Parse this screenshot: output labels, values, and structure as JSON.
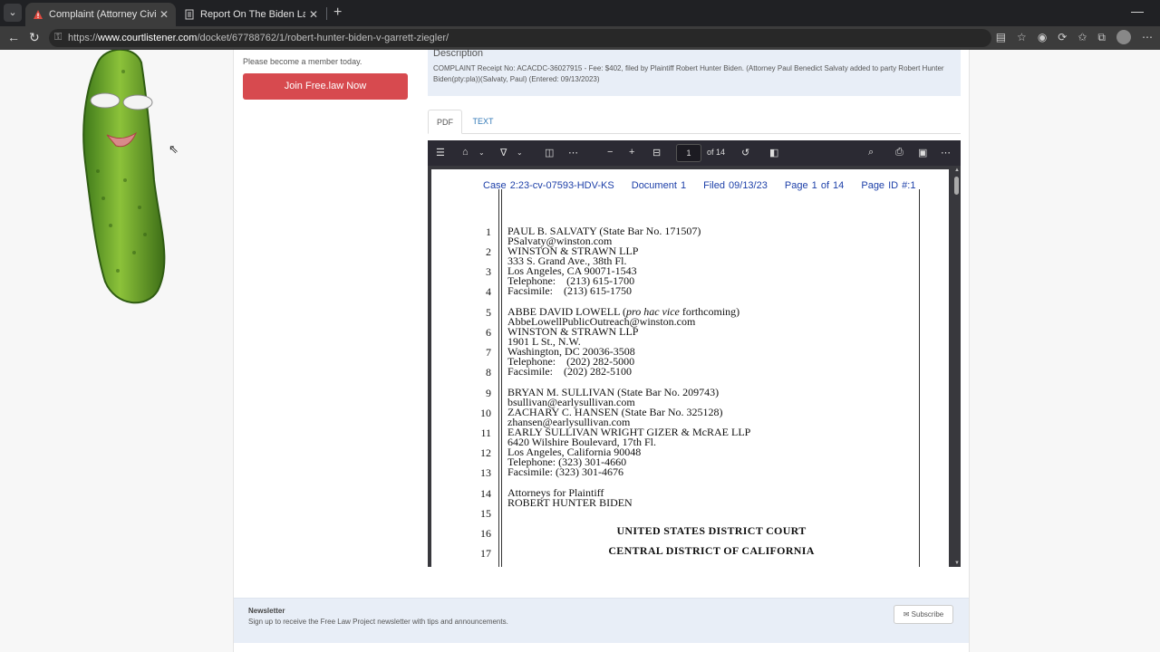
{
  "browser": {
    "tabs": [
      {
        "title": "Complaint (Attorney Civil Case Op",
        "active": true
      },
      {
        "title": "Report On The Biden Laptop : Mar",
        "active": false
      }
    ],
    "url_prefix": "https://",
    "url_host": "www.courtlistener.com",
    "url_path": "/docket/67788762/1/robert-hunter-biden-v-garrett-ziegler/"
  },
  "sidebar": {
    "member_text": "Please become a member today.",
    "join_label": "Join Free.law Now"
  },
  "description": {
    "title": "Description",
    "body": "COMPLAINT Receipt No: ACACDC-36027915 - Fee: $402, filed by Plaintiff Robert Hunter Biden. (Attorney Paul Benedict Salvaty added to party Robert Hunter Biden(pty:pla))(Salvaty, Paul) (Entered: 09/13/2023)"
  },
  "pdf_tabs": {
    "pdf": "PDF",
    "text": "TEXT"
  },
  "viewer": {
    "page_number": "1",
    "page_total": "of 14"
  },
  "document": {
    "header": {
      "case": "Case 2:23-cv-07593-HDV-KS",
      "doc": "Document 1",
      "filed": "Filed 09/13/23",
      "page": "Page 1 of 14",
      "page_id": "Page ID #:1"
    },
    "lines": {
      "l1": "PAUL B. SALVATY (State Bar No. 171507)",
      "l1b": "PSalvaty@winston.com",
      "l2": "WINSTON & STRAWN LLP",
      "l2b": "333 S. Grand Ave., 38th Fl.",
      "l3": "Los Angeles, CA 90071-1543",
      "l3b": "Telephone:    (213) 615-1700",
      "l4": "Facsimile:    (213) 615-1750",
      "l5_pre": "ABBE DAVID LOWELL (",
      "l5_it": "pro hac vice",
      "l5_post": " forthcoming)",
      "l5b": "AbbeLowellPublicOutreach@winston.com",
      "l6": "WINSTON & STRAWN LLP",
      "l6b": "1901 L St., N.W.",
      "l7": "Washington, DC 20036-3508",
      "l7b": "Telephone:    (202) 282-5000",
      "l8": "Facsimile:    (202) 282-5100",
      "l9": "BRYAN M. SULLIVAN (State Bar No. 209743)",
      "l9b": "bsullivan@earlysullivan.com",
      "l10": "ZACHARY C. HANSEN (State Bar No. 325128)",
      "l10b": "zhansen@earlysullivan.com",
      "l11": "EARLY SULLIVAN WRIGHT GIZER & McRAE LLP",
      "l11b": "6420 Wilshire Boulevard, 17th Fl.",
      "l12": "Los Angeles, California 90048",
      "l12b": "Telephone: (323) 301-4660",
      "l13": "Facsimile: (323) 301-4676",
      "l14": "Attorneys for Plaintiff",
      "l14b": "ROBERT HUNTER BIDEN",
      "l16": "UNITED STATES DISTRICT COURT",
      "l17": "CENTRAL DISTRICT OF CALIFORNIA"
    },
    "line_numbers": [
      "1",
      "2",
      "3",
      "4",
      "5",
      "6",
      "7",
      "8",
      "9",
      "10",
      "11",
      "12",
      "13",
      "14",
      "15",
      "16",
      "17"
    ]
  },
  "newsletter": {
    "title": "Newsletter",
    "subtitle": "Sign up to receive the Free Law Project newsletter with tips and announcements.",
    "subscribe": "Subscribe"
  }
}
